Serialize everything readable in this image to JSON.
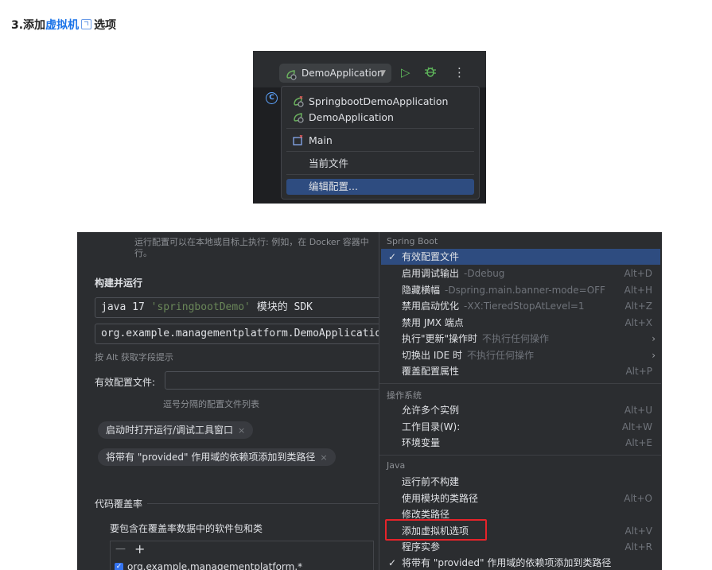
{
  "heading": {
    "prefix": "3.添加",
    "link": "虚拟机",
    "suffix": "选项"
  },
  "screenshot1": {
    "run_config": "DemoApplication",
    "menu_items": [
      {
        "label": "SpringbootDemoApplication",
        "icon": "spring-boot-error-icon"
      },
      {
        "label": "DemoApplication",
        "icon": "spring-boot-icon"
      },
      {
        "label": "Main",
        "icon": "application-error-icon"
      },
      {
        "label": "当前文件",
        "icon": ""
      },
      {
        "label": "编辑配置...",
        "icon": "",
        "selected": true
      }
    ]
  },
  "screenshot2": {
    "top_text_line1": "运行配置可以在本地或目标上执行: 例如，在 Docker 容器中",
    "top_text_line2": "行。",
    "section_build_run": "构建并运行",
    "sdk_field_main": "java 17",
    "sdk_field_comment": "'springbootDemo'",
    "sdk_field_tail": "模块的 SDK",
    "main_class": "org.example.managementplatform.DemoApplicatio",
    "alt_hint": "按 Alt 获取字段提示",
    "active_profiles_label": "有效配置文件:",
    "active_profiles_value": "",
    "active_profiles_hint": "逗号分隔的配置文件列表",
    "chip1": "启动时打开运行/调试工具窗口",
    "chip2": "将带有 \"provided\" 作用域的依赖项添加到类路径",
    "chip_close": "×",
    "section_coverage": "代码覆盖率",
    "coverage_label": "要包含在覆盖率数据中的软件包和类",
    "list_toolbar_minus": "—",
    "list_toolbar_plus": "+",
    "list_item": "org.example.managementplatform.*",
    "menu": {
      "groups": [
        {
          "title": "Spring Boot",
          "items": [
            {
              "label": "有效配置文件",
              "hint": "",
              "shortcut": "",
              "checked": true,
              "selected": true
            },
            {
              "label": "启用调试输出",
              "hint": "-Ddebug",
              "shortcut": "Alt+D"
            },
            {
              "label": "隐藏横幅",
              "hint": "-Dspring.main.banner-mode=OFF",
              "shortcut": "Alt+H"
            },
            {
              "label": "禁用启动优化",
              "hint": "-XX:TieredStopAtLevel=1",
              "shortcut": "Alt+Z"
            },
            {
              "label": "禁用 JMX 端点",
              "hint": "",
              "shortcut": "Alt+X"
            },
            {
              "label": "执行\"更新\"操作时",
              "hint": "不执行任何操作",
              "shortcut": "",
              "submenu": true
            },
            {
              "label": "切换出 IDE 时",
              "hint": "不执行任何操作",
              "shortcut": "",
              "submenu": true
            },
            {
              "label": "覆盖配置属性",
              "hint": "",
              "shortcut": "Alt+P"
            }
          ]
        },
        {
          "title": "操作系统",
          "items": [
            {
              "label": "允许多个实例",
              "hint": "",
              "shortcut": "Alt+U"
            },
            {
              "label": "工作目录(W):",
              "hint": "",
              "shortcut": "Alt+W"
            },
            {
              "label": "环境变量",
              "hint": "",
              "shortcut": "Alt+E"
            }
          ]
        },
        {
          "title": "Java",
          "items": [
            {
              "label": "运行前不构建",
              "hint": "",
              "shortcut": ""
            },
            {
              "label": "使用模块的类路径",
              "hint": "",
              "shortcut": "Alt+O"
            },
            {
              "label": "修改类路径",
              "hint": "",
              "shortcut": ""
            },
            {
              "label": "添加虚拟机选项",
              "hint": "",
              "shortcut": "Alt+V",
              "highlighted": true
            },
            {
              "label": "程序实参",
              "hint": "",
              "shortcut": "Alt+R"
            },
            {
              "label": "将带有 \"provided\" 作用域的依赖项添加到类路径",
              "hint": "",
              "shortcut": "",
              "checked": true
            }
          ]
        }
      ]
    }
  },
  "colors": {
    "ide_bg": "#2b2d30",
    "editor_bg": "#1e1f22",
    "selection": "#2e4c80",
    "highlight_box": "#e5232a",
    "link": "#1a73e8"
  }
}
